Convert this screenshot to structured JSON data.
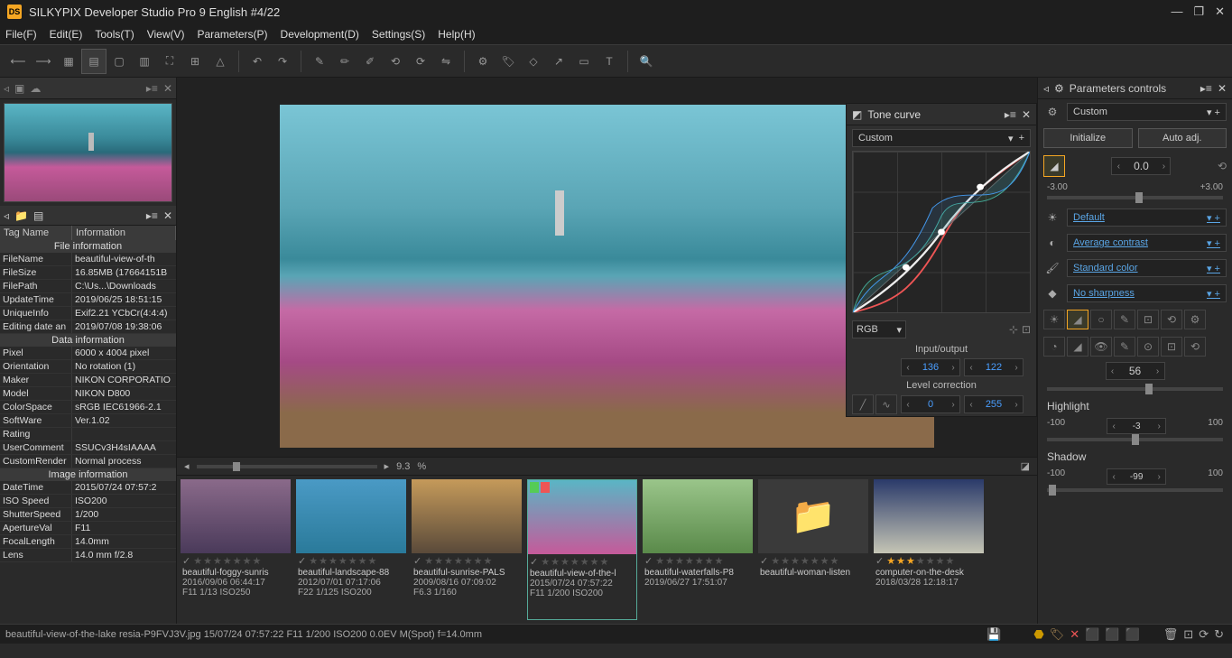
{
  "app": {
    "title": "SILKYPIX Developer Studio Pro 9 English   #4/22"
  },
  "menu": [
    "File(F)",
    "Edit(E)",
    "Tools(T)",
    "View(V)",
    "Parameters(P)",
    "Development(D)",
    "Settings(S)",
    "Help(H)"
  ],
  "info": {
    "tag": "Tag Name",
    "infoCol": "Information",
    "sections": {
      "file": "File information",
      "data": "Data information",
      "image": "Image information"
    },
    "rows": [
      {
        "k": "FileName",
        "v": "beautiful-view-of-th"
      },
      {
        "k": "FileSize",
        "v": "16.85MB (17664151B"
      },
      {
        "k": "FilePath",
        "v": "C:\\Us...\\Downloads"
      },
      {
        "k": "UpdateTime",
        "v": "2019/06/25 18:51:15"
      },
      {
        "k": "UniqueInfo",
        "v": "Exif2.21 YCbCr(4:4:4)"
      },
      {
        "k": "Editing date an",
        "v": "2019/07/08 19:38:06"
      }
    ],
    "dataRows": [
      {
        "k": "Pixel",
        "v": "6000 x 4004 pixel"
      },
      {
        "k": "Orientation",
        "v": "No rotation (1)"
      },
      {
        "k": "Maker",
        "v": "NIKON CORPORATIO"
      },
      {
        "k": "Model",
        "v": "NIKON D800"
      },
      {
        "k": "ColorSpace",
        "v": "sRGB IEC61966-2.1"
      },
      {
        "k": "SoftWare",
        "v": "Ver.1.02"
      },
      {
        "k": "Rating",
        "v": ""
      },
      {
        "k": "UserComment",
        "v": "SSUCv3H4sIAAAA"
      },
      {
        "k": "CustomRender",
        "v": "Normal process"
      }
    ],
    "imageRows": [
      {
        "k": "DateTime",
        "v": "2015/07/24 07:57:2"
      },
      {
        "k": "ISO Speed",
        "v": "ISO200"
      },
      {
        "k": "ShutterSpeed",
        "v": "1/200"
      },
      {
        "k": "ApertureVal",
        "v": "F11"
      },
      {
        "k": "FocalLength",
        "v": "14.0mm"
      },
      {
        "k": "Lens",
        "v": "14.0 mm f/2.8"
      }
    ]
  },
  "tone": {
    "title": "Tone curve",
    "preset": "Custom",
    "channel": "RGB",
    "ioLabel": "Input/output",
    "input": "136",
    "output": "122",
    "levelLabel": "Level correction",
    "level1": "0",
    "level2": "255"
  },
  "zoom": {
    "value": "9.3",
    "unit": "%"
  },
  "thumbs": [
    {
      "name": "beautiful-foggy-sunris",
      "date": "2016/09/06 06:44:17",
      "meta": "F11 1/13 ISO250",
      "stars": 0,
      "bg": "linear-gradient(180deg,#8a6a8a,#4a3a5a)"
    },
    {
      "name": "beautiful-landscape-88",
      "date": "2012/07/01 07:17:06",
      "meta": "F22 1/125 ISO200",
      "stars": 0,
      "bg": "linear-gradient(180deg,#4a9ac5,#2a7a9a)"
    },
    {
      "name": "beautiful-sunrise-PALS",
      "date": "2009/08/16 07:09:02",
      "meta": "F6.3 1/160",
      "stars": 0,
      "bg": "linear-gradient(180deg,#c59a5a,#5a4a3a)"
    },
    {
      "name": "beautiful-view-of-the-l",
      "date": "2015/07/24 07:57:22",
      "meta": "F11 1/200 ISO200",
      "stars": 0,
      "bg": "linear-gradient(180deg,#5ab5c5,#c55a9a)",
      "sel": true,
      "flags": [
        "#5c5",
        "#e55"
      ]
    },
    {
      "name": "beautiful-waterfalls-P8",
      "date": "2019/06/27 17:51:07",
      "meta": "",
      "stars": 0,
      "bg": "linear-gradient(180deg,#9ac58a,#5a8a4a)"
    },
    {
      "name": "beautiful-woman-listen",
      "date": "",
      "meta": "",
      "stars": 0,
      "bg": "#3a3a3a",
      "folder": true
    },
    {
      "name": "computer-on-the-desk",
      "date": "2018/03/28 12:18:17",
      "meta": "",
      "stars": 3,
      "bg": "linear-gradient(180deg,#2a3a6a,#c5c5b5)"
    }
  ],
  "right": {
    "title": "Parameters controls",
    "preset": "Custom",
    "init": "Initialize",
    "auto": "Auto adj.",
    "expVal": "0.0",
    "expMin": "-3.00",
    "expMax": "+3.00",
    "wb": "Default",
    "contrast": "Average contrast",
    "color": "Standard color",
    "sharp": "No sharpness",
    "sat": "56",
    "highlightLabel": "Highlight",
    "hlMin": "-100",
    "hlVal": "-3",
    "hlMax": "100",
    "shadowLabel": "Shadow",
    "shMin": "-100",
    "shVal": "-99",
    "shMax": "100"
  },
  "status": "beautiful-view-of-the-lake resia-P9FVJ3V.jpg 15/07/24 07:57:22 F11 1/200 ISO200  0.0EV M(Spot) f=14.0mm"
}
